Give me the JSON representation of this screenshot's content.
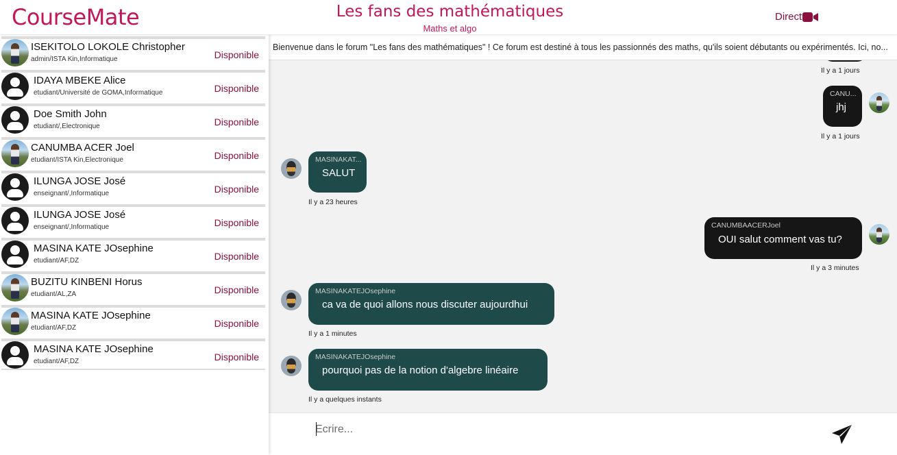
{
  "app": {
    "logo": "CourseMate"
  },
  "header": {
    "forum_title": "Les fans des mathématiques",
    "forum_subtitle": "Maths et algo",
    "direct_label": "Direct",
    "direct_icon": "video-camera-icon",
    "accent_color": "#c3175b"
  },
  "sidebar": {
    "users": [
      {
        "name": "ISEKITOLO LOKOLE Christopher",
        "role": "admin/ISTA Kin,Informatique",
        "status": "Disponible",
        "avatar": "photo"
      },
      {
        "name": "IDAYA MBEKE Alice",
        "role": "etudiant/Université de GOMA,Informatique",
        "status": "Disponible",
        "avatar": "default"
      },
      {
        "name": "Doe Smith John",
        "role": "etudiant/,Electronique",
        "status": "Disponible",
        "avatar": "default"
      },
      {
        "name": "CANUMBA ACER Joel",
        "role": "etudiant/ISTA Kin,Electronique",
        "status": "Disponible",
        "avatar": "photo"
      },
      {
        "name": "ILUNGA JOSE José",
        "role": "enseignant/,Informatique",
        "status": "Disponible",
        "avatar": "default"
      },
      {
        "name": "ILUNGA JOSE José",
        "role": "enseignant/,Informatique",
        "status": "Disponible",
        "avatar": "default"
      },
      {
        "name": "MASINA KATE JOsephine",
        "role": "etudiant/AF,DZ",
        "status": "Disponible",
        "avatar": "default"
      },
      {
        "name": "BUZITU KINBENI Horus",
        "role": "etudiant/AL,ZA",
        "status": "Disponible",
        "avatar": "photo"
      },
      {
        "name": "MASINA KATE JOsephine",
        "role": "etudiant/AF,DZ",
        "status": "Disponible",
        "avatar": "photo"
      },
      {
        "name": "MASINA KATE JOsephine",
        "role": "etudiant/AF,DZ",
        "status": "Disponible",
        "avatar": "default"
      }
    ]
  },
  "chat": {
    "welcome": "Bienvenue dans le forum \"Les fans des mathématiques\" ! Ce forum est destiné à tous les passionnés des maths, qu'ils soient débutants ou expérimentés. Ici, no...",
    "messages": [
      {
        "direction": "out",
        "author": "",
        "text": "",
        "time": "Il y a 1 jours"
      },
      {
        "direction": "out",
        "author": "CANU...",
        "text": "jhj",
        "time": "Il y a 1 jours"
      },
      {
        "direction": "in",
        "author": "MASINAKAT...",
        "text": "SALUT",
        "time": "Il y a 23 heures"
      },
      {
        "direction": "out",
        "author": "CANUMBAACERJoel",
        "text": "OUI salut comment vas tu?",
        "time": "Il y a 3 minutes"
      },
      {
        "direction": "in",
        "author": "MASINAKATEJOsephine",
        "text": "ca va de quoi allons nous discuter aujourdhui",
        "time": "Il y a 1 minutes"
      },
      {
        "direction": "in",
        "author": "MASINAKATEJOsephine",
        "text": "pourquoi pas de la notion d'algebre linéaire",
        "time": "Il y a quelques instants"
      }
    ],
    "incoming_color": "#1e4b4a",
    "outgoing_color": "#161616"
  },
  "composer": {
    "placeholder": "Ecrire...",
    "value": "",
    "send_icon": "paper-plane-icon"
  }
}
